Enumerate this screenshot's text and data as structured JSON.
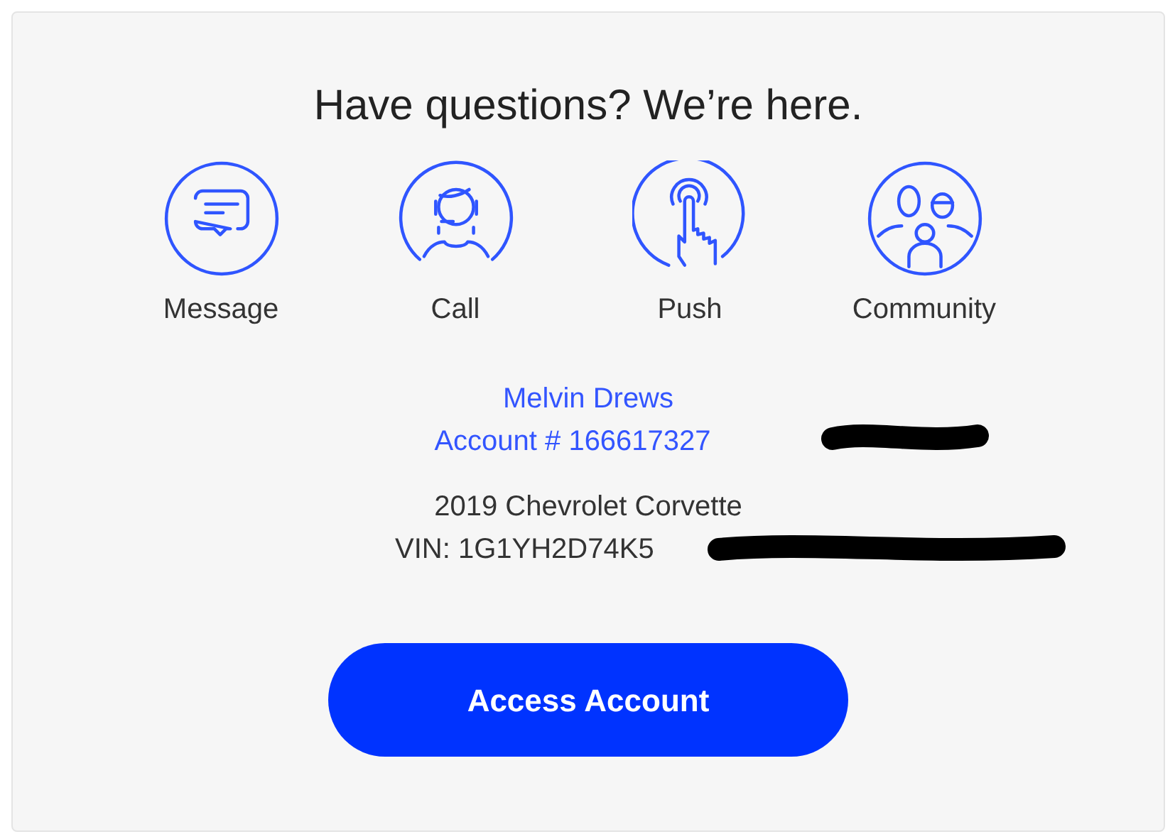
{
  "title": "Have questions? We’re here.",
  "channels": [
    {
      "kind": "message",
      "label": "Message"
    },
    {
      "kind": "call",
      "label": "Call"
    },
    {
      "kind": "push",
      "label": "Push"
    },
    {
      "kind": "community",
      "label": "Community"
    }
  ],
  "account": {
    "name": "Melvin Drews",
    "number": "Account # 166617327"
  },
  "vehicle": {
    "model": "2019 Chevrolet Corvette",
    "vin": "VIN: 1G1YH2D74K5"
  },
  "button": "Access Account"
}
